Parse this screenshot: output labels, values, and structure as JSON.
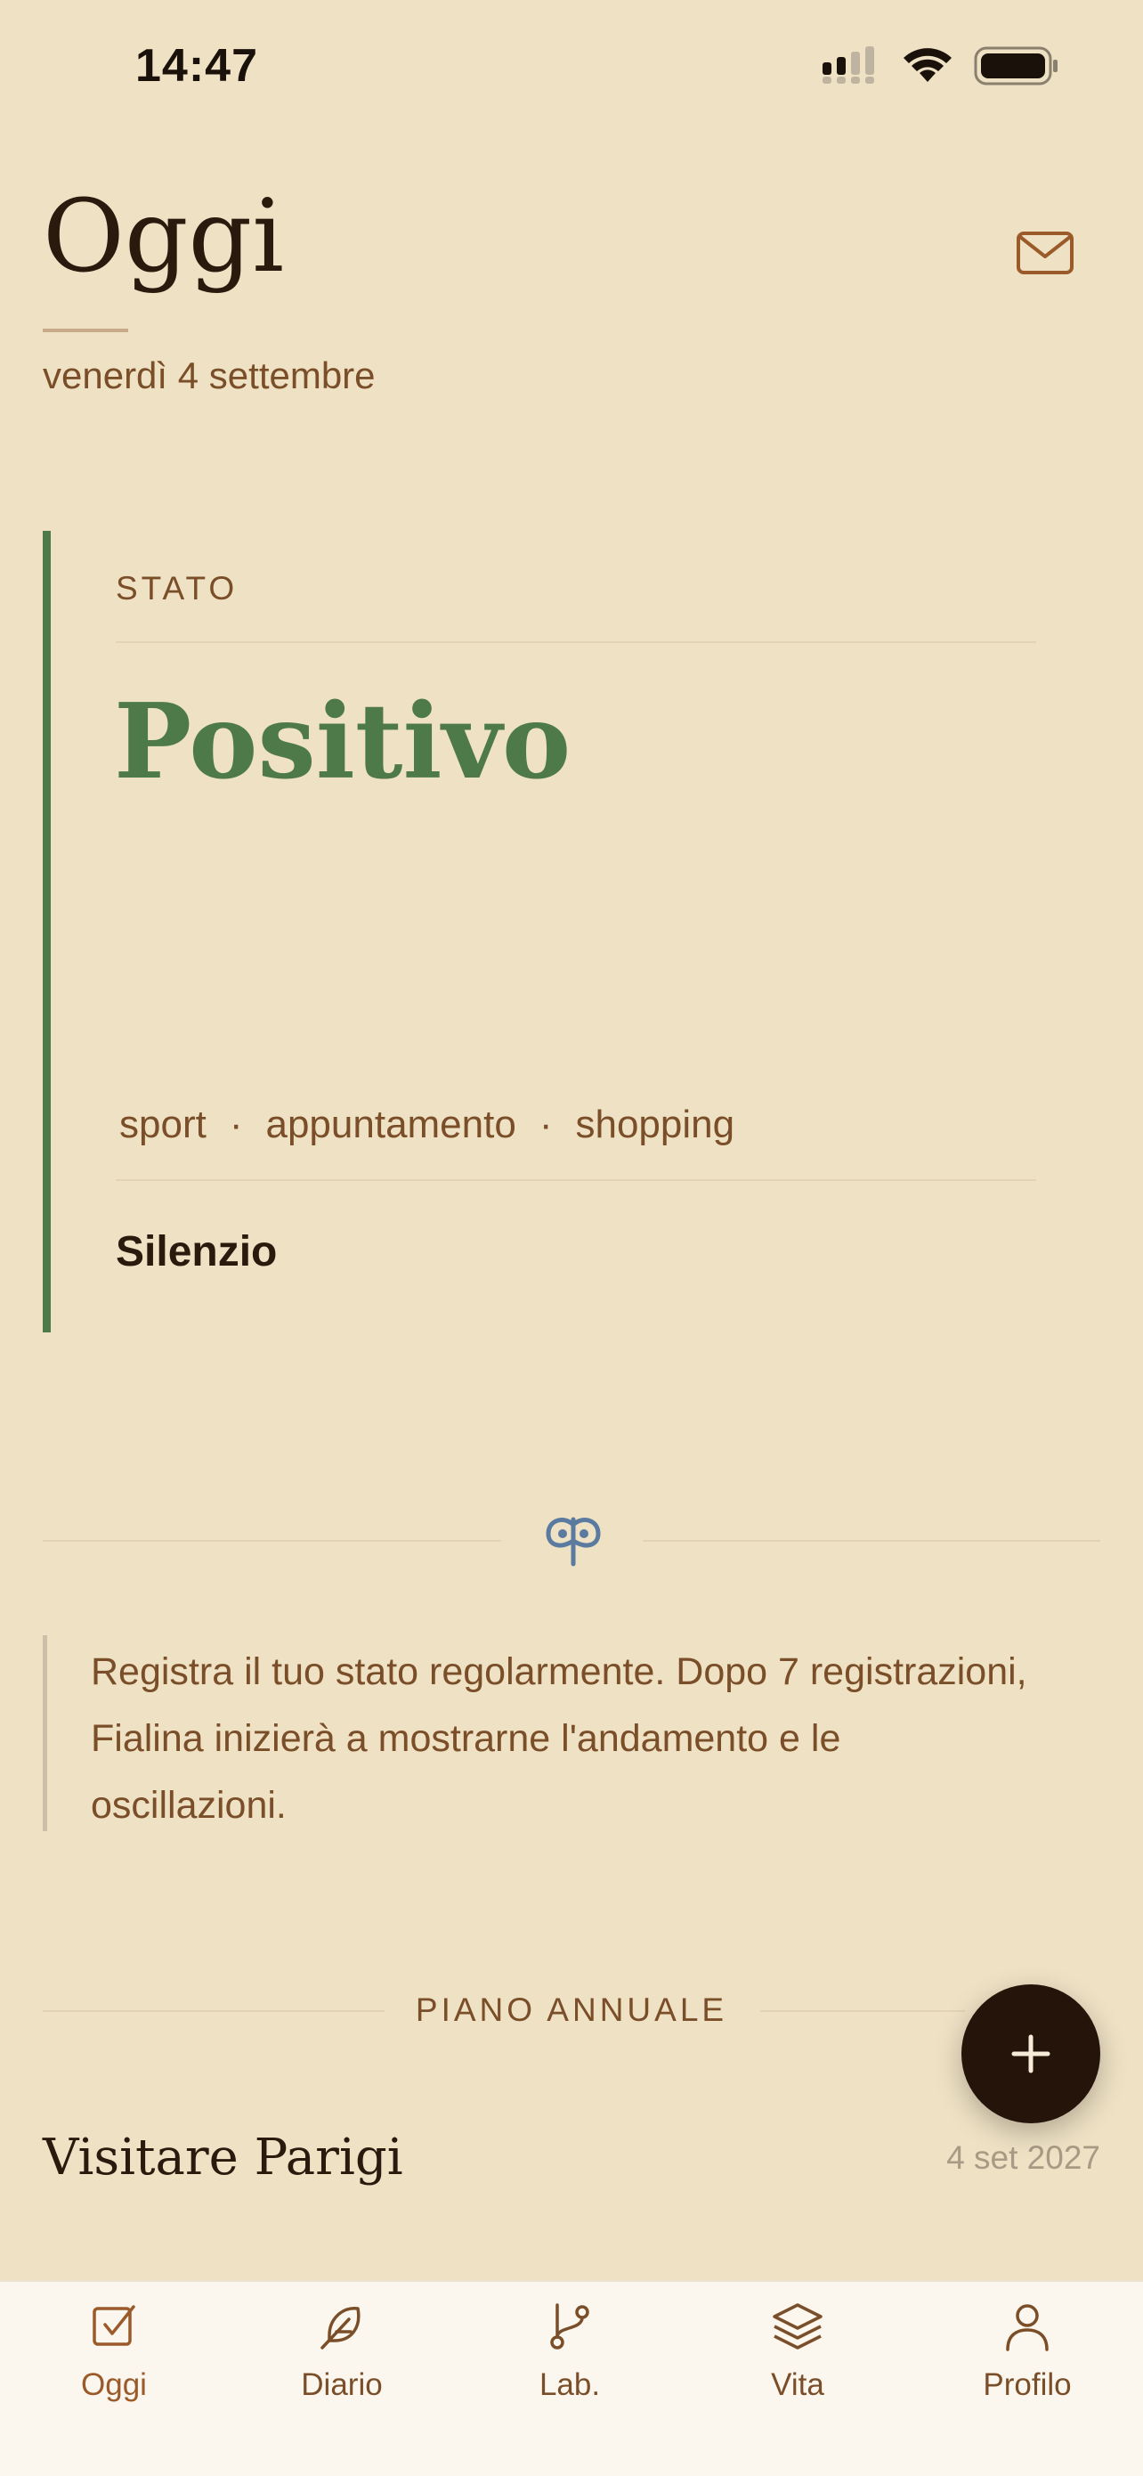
{
  "status_bar": {
    "time": "14:47"
  },
  "header": {
    "title": "Oggi",
    "date": "venerdì 4 settembre",
    "mail_icon": "mail-icon"
  },
  "state_card": {
    "label": "STATO",
    "value": "Positivo",
    "tags": [
      "sport",
      "appuntamento",
      "shopping"
    ],
    "tag_separator": "·",
    "note": "Silenzio",
    "accent_color": "#4E7A4A"
  },
  "info": {
    "text": "Registra il tuo stato regolarmente. Dopo 7 registrazioni, Fialina inizierà a mostrarne l'andamento e le oscillazioni."
  },
  "plan": {
    "section_title": "PIANO ANNUALE",
    "items": [
      {
        "title": "Visitare Parigi",
        "date": "4 set 2027"
      }
    ]
  },
  "fab": {
    "icon": "plus-icon"
  },
  "tab_bar": {
    "items": [
      {
        "label": "Oggi",
        "icon": "checkbox-icon"
      },
      {
        "label": "Diario",
        "icon": "feather-icon"
      },
      {
        "label": "Lab.",
        "icon": "git-branch-icon"
      },
      {
        "label": "Vita",
        "icon": "layers-icon"
      },
      {
        "label": "Profilo",
        "icon": "user-icon"
      }
    ],
    "active": "Oggi"
  },
  "colors": {
    "background": "#EEE1C4",
    "accent": "#7A4E28",
    "positive": "#4E7A4A",
    "ornament": "#5A7AA0",
    "fab": "#24140A"
  }
}
